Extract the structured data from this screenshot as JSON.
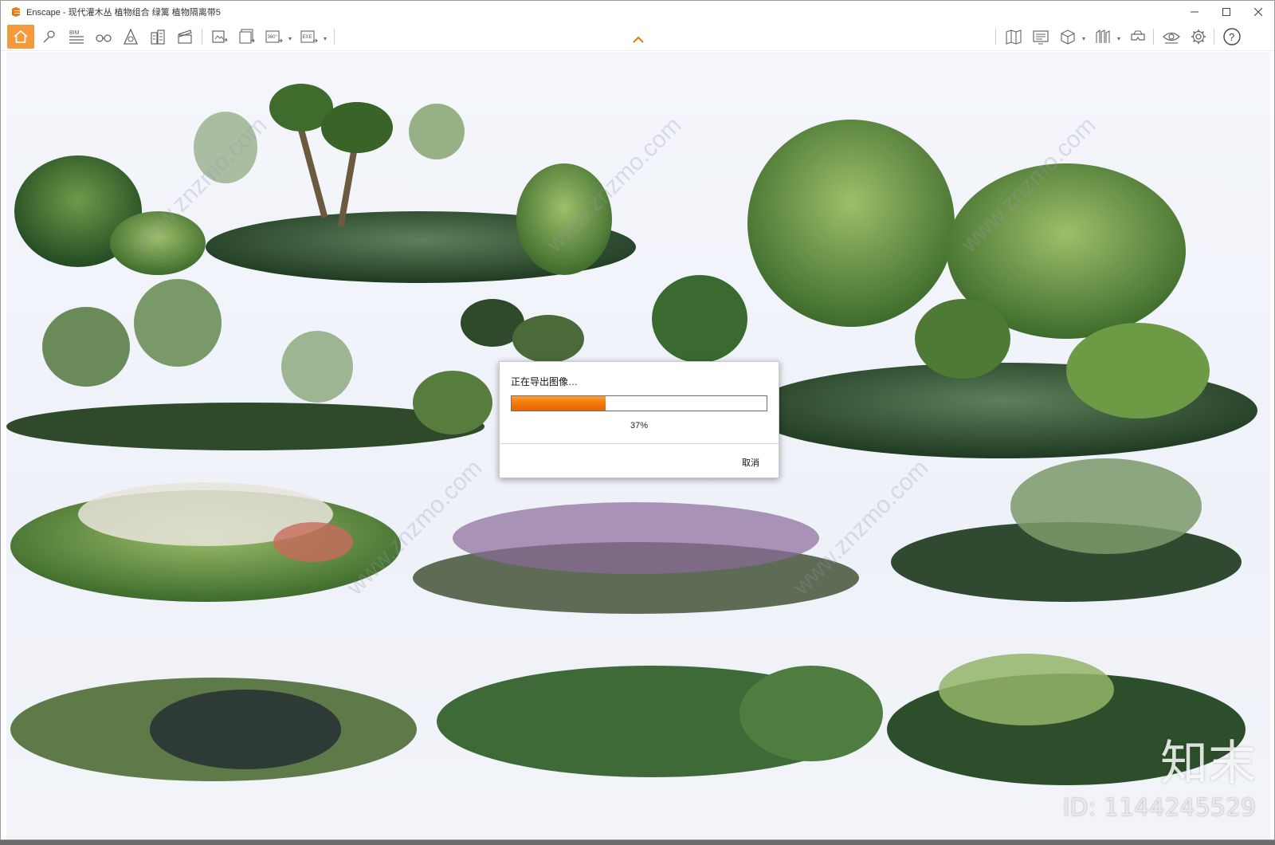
{
  "window": {
    "title": "Enscape - 现代灌木丛 植物组合 绿篱 植物隔离带5",
    "controls": [
      "minimize",
      "maximize",
      "close"
    ]
  },
  "toolbar": {
    "left_icons": [
      "home-icon",
      "location-pin-icon",
      "bim-icon",
      "binoculars-icon",
      "asset-library-icon",
      "buildings-icon",
      "clapper-icon"
    ],
    "export_icons": [
      "screenshot-export-icon",
      "batch-render-icon",
      "panorama-360-icon",
      "exe-export-icon"
    ],
    "right_icons": [
      "map-icon",
      "monitor-icon",
      "cube-view-icon",
      "atlas-icon",
      "vr-headset-icon",
      "eye-visual-settings-icon",
      "gear-icon",
      "help-icon"
    ],
    "bim_label": "BIM",
    "pano_label": "360°",
    "exe_label": "EXE",
    "help_label": "?"
  },
  "dialog": {
    "title": "正在导出图像…",
    "progress_percent": 37,
    "progress_text": "37%",
    "cancel_label": "取消",
    "accent_color": "#f07406"
  },
  "viewport": {
    "watermark_text": "www.znzmo.com",
    "brand_logo_text": "知末",
    "brand_id": "ID: 1144245529"
  }
}
